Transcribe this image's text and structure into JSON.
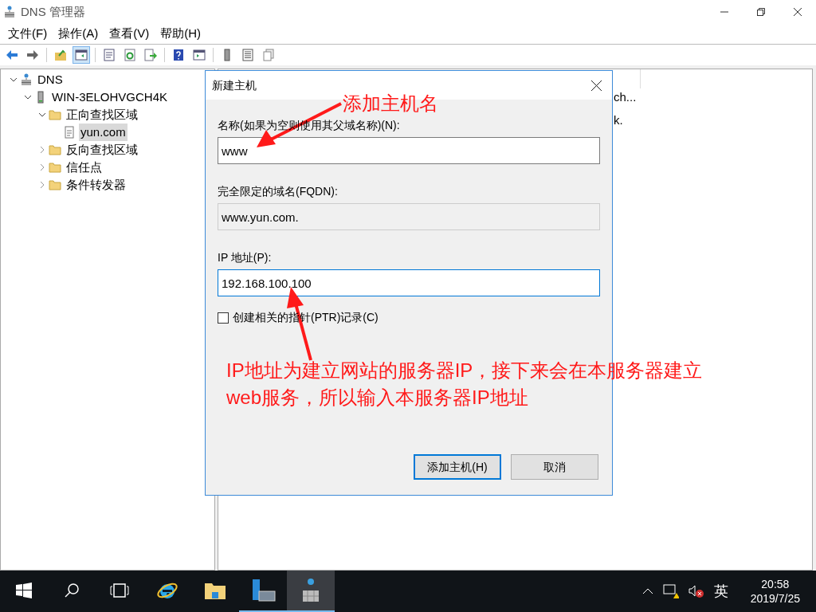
{
  "window": {
    "title": "DNS 管理器"
  },
  "menu": [
    "文件(F)",
    "操作(A)",
    "查看(V)",
    "帮助(H)"
  ],
  "toolbar": [
    {
      "kind": "back",
      "pressed": false
    },
    {
      "kind": "forward",
      "pressed": false
    },
    {
      "kind": "sep"
    },
    {
      "kind": "up",
      "pressed": false
    },
    {
      "kind": "tree",
      "pressed": true
    },
    {
      "kind": "sep"
    },
    {
      "kind": "props",
      "pressed": false
    },
    {
      "kind": "refresh",
      "pressed": false
    },
    {
      "kind": "export",
      "pressed": false
    },
    {
      "kind": "sep"
    },
    {
      "kind": "help",
      "pressed": false
    },
    {
      "kind": "pane",
      "pressed": false
    },
    {
      "kind": "sep"
    },
    {
      "kind": "server",
      "pressed": false
    },
    {
      "kind": "list",
      "pressed": false
    },
    {
      "kind": "copy",
      "pressed": false
    }
  ],
  "tree": [
    {
      "label": "DNS",
      "kind": "dns",
      "expanded": true,
      "selected": false,
      "children": [
        {
          "label": "WIN-3ELOHVGCH4K",
          "kind": "server",
          "expanded": true,
          "selected": false,
          "children": [
            {
              "label": "正向查找区域",
              "kind": "folder",
              "expanded": true,
              "selected": false,
              "children": [
                {
                  "label": "yun.com",
                  "kind": "zone",
                  "selected": true
                }
              ]
            },
            {
              "label": "反向查找区域",
              "kind": "folder",
              "expanded": false,
              "selected": false
            },
            {
              "label": "信任点",
              "kind": "folder",
              "expanded": false,
              "selected": false
            },
            {
              "label": "条件转发器",
              "kind": "folder",
              "expanded": false,
              "selected": false
            }
          ]
        }
      ]
    }
  ],
  "right_pane": {
    "rows": [
      "ch...",
      "k."
    ]
  },
  "dialog": {
    "title": "新建主机",
    "name_field": {
      "label": "名称(如果为空则使用其父域名称)(N):",
      "value": "www"
    },
    "fqdn_field": {
      "label": "完全限定的域名(FQDN):",
      "value": "www.yun.com."
    },
    "ip_field": {
      "label": "IP 地址(P):",
      "value": "192.168.100.100",
      "focused": true
    },
    "ptr_checkbox": {
      "label": "创建相关的指针(PTR)记录(C)",
      "checked": false
    },
    "buttons": [
      {
        "label": "添加主机(H)",
        "default": true
      },
      {
        "label": "取消",
        "default": false
      }
    ]
  },
  "annotations": [
    {
      "text": "添加主机名"
    },
    {
      "text": "IP地址为建立网站的服务器IP，接下来会在本服务器建立web服务，所以输入本服务器IP地址"
    }
  ],
  "taskbar": {
    "apps": [
      {
        "kind": "start",
        "running": false,
        "active": false
      },
      {
        "kind": "search",
        "running": false,
        "active": false
      },
      {
        "kind": "taskview",
        "running": false,
        "active": false
      },
      {
        "kind": "ie",
        "running": false,
        "active": false
      },
      {
        "kind": "explorer",
        "running": false,
        "active": false
      },
      {
        "kind": "servermanager",
        "running": true,
        "active": false
      },
      {
        "kind": "dns",
        "running": true,
        "active": true
      }
    ],
    "input_method": "英",
    "time": "20:58",
    "date": "2019/7/25"
  }
}
